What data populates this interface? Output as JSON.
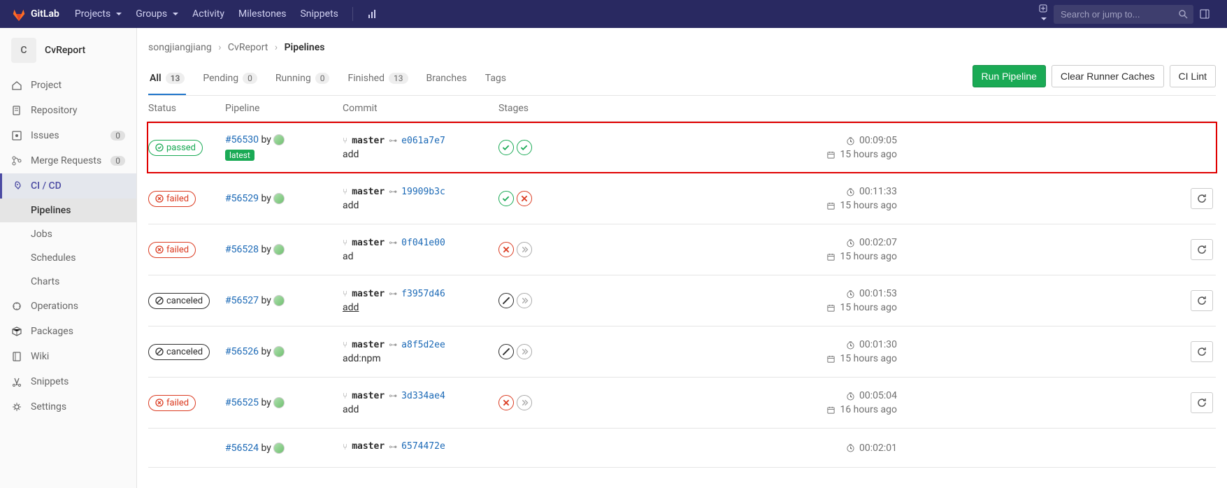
{
  "topnav": {
    "brand": "GitLab",
    "items": [
      "Projects",
      "Groups",
      "Activity",
      "Milestones",
      "Snippets"
    ],
    "search_placeholder": "Search or jump to..."
  },
  "sidebar": {
    "project_initial": "C",
    "project_name": "CvReport",
    "items": [
      {
        "icon": "home",
        "label": "Project"
      },
      {
        "icon": "doc",
        "label": "Repository"
      },
      {
        "icon": "issues",
        "label": "Issues",
        "badge": "0"
      },
      {
        "icon": "merge",
        "label": "Merge Requests",
        "badge": "0"
      },
      {
        "icon": "rocket",
        "label": "CI / CD",
        "active": true,
        "sub": [
          {
            "label": "Pipelines",
            "active": true
          },
          {
            "label": "Jobs"
          },
          {
            "label": "Schedules"
          },
          {
            "label": "Charts"
          }
        ]
      },
      {
        "icon": "ops",
        "label": "Operations"
      },
      {
        "icon": "package",
        "label": "Packages"
      },
      {
        "icon": "wiki",
        "label": "Wiki"
      },
      {
        "icon": "snippet",
        "label": "Snippets"
      },
      {
        "icon": "gear",
        "label": "Settings"
      }
    ]
  },
  "breadcrumb": {
    "parts": [
      "songjiangjiang",
      "CvReport"
    ],
    "current": "Pipelines"
  },
  "tabs": [
    {
      "label": "All",
      "count": "13",
      "active": true
    },
    {
      "label": "Pending",
      "count": "0"
    },
    {
      "label": "Running",
      "count": "0"
    },
    {
      "label": "Finished",
      "count": "13"
    },
    {
      "label": "Branches"
    },
    {
      "label": "Tags"
    }
  ],
  "actions": {
    "run": "Run Pipeline",
    "clear": "Clear Runner Caches",
    "lint": "CI Lint"
  },
  "columns": {
    "status": "Status",
    "pipeline": "Pipeline",
    "commit": "Commit",
    "stages": "Stages"
  },
  "pipelines": [
    {
      "status": "passed",
      "status_label": "passed",
      "id": "#56530",
      "latest": true,
      "branch": "master",
      "sha": "e061a7e7",
      "msg": "add",
      "stages": [
        "passed",
        "passed"
      ],
      "duration": "00:09:05",
      "ago": "15 hours ago",
      "highlight": true,
      "retry": false
    },
    {
      "status": "failed",
      "status_label": "failed",
      "id": "#56529",
      "branch": "master",
      "sha": "19909b3c",
      "msg": "add",
      "stages": [
        "passed",
        "failed"
      ],
      "duration": "00:11:33",
      "ago": "15 hours ago",
      "retry": true
    },
    {
      "status": "failed",
      "status_label": "failed",
      "id": "#56528",
      "branch": "master",
      "sha": "0f041e00",
      "msg": "ad",
      "stages": [
        "failed",
        "skipped"
      ],
      "duration": "00:02:07",
      "ago": "15 hours ago",
      "retry": true
    },
    {
      "status": "canceled",
      "status_label": "canceled",
      "id": "#56527",
      "branch": "master",
      "sha": "f3957d46",
      "msg": "add",
      "msg_underline": true,
      "stages": [
        "canceled",
        "skipped"
      ],
      "duration": "00:01:53",
      "ago": "15 hours ago",
      "retry": true
    },
    {
      "status": "canceled",
      "status_label": "canceled",
      "id": "#56526",
      "branch": "master",
      "sha": "a8f5d2ee",
      "msg": "add:npm",
      "stages": [
        "canceled",
        "skipped"
      ],
      "duration": "00:01:30",
      "ago": "15 hours ago",
      "retry": true
    },
    {
      "status": "failed",
      "status_label": "failed",
      "id": "#56525",
      "branch": "master",
      "sha": "3d334ae4",
      "msg": "add",
      "stages": [
        "failed",
        "skipped"
      ],
      "duration": "00:05:04",
      "ago": "16 hours ago",
      "retry": true
    },
    {
      "status": "",
      "status_label": "",
      "id": "#56524",
      "branch": "master",
      "sha": "6574472e",
      "msg": "",
      "stages": [],
      "duration": "00:02:01",
      "ago": "",
      "retry": false,
      "partial": true
    }
  ],
  "by_label": "by"
}
